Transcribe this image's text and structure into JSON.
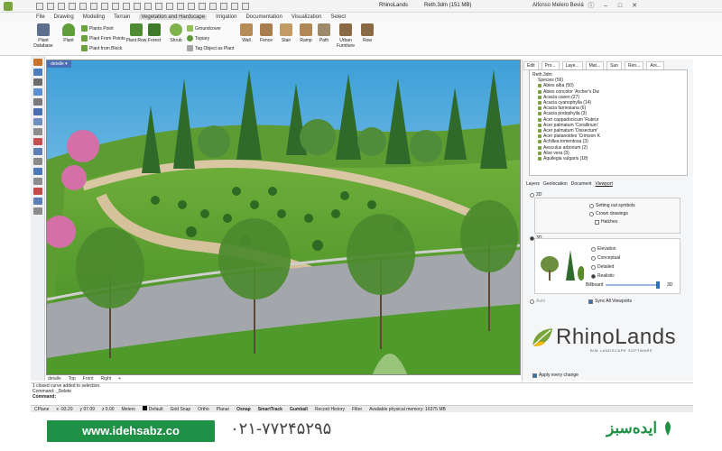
{
  "titlebar": {
    "app_title": "RhinoLands",
    "file_title": "Reth.3dm (151 MB)",
    "user": "Alfonso Melero Beviá"
  },
  "menu": [
    "File",
    "Drawing",
    "Modeling",
    "Terrain",
    "Vegetation and Hardscape",
    "Irrigation",
    "Documentation",
    "Visualization",
    "Select"
  ],
  "ribbon": {
    "plant_database": "Plant Database",
    "plant": "Plant",
    "plants_point": "Plants Point",
    "plant_from_points": "Plant From Points",
    "plant_from_block": "Plant from Block",
    "plant_row": "Plant Row",
    "forest": "Forest",
    "shrub": "Shrub",
    "groundcover": "Groundcover",
    "topiary": "Topiary",
    "tag_object": "Tag Object as Plant",
    "wall": "Wall",
    "fence": "Fence",
    "stair": "Stair",
    "ramp": "Ramp",
    "path": "Path",
    "urban_furniture": "Urban Furniture",
    "row": "Row"
  },
  "viewport": {
    "label": "detalle ▾",
    "tabs": [
      "detalle",
      "Top",
      "Front",
      "Right",
      "+"
    ]
  },
  "panel": {
    "tabs": [
      "Edit",
      "Pro...",
      "Laye...",
      "Mat...",
      "Sun",
      "Ren...",
      "Ani..."
    ],
    "tree_root": "Reth.3dm",
    "tree_group": "Species (56)",
    "species": [
      "Abies alba  (50)",
      "Abies concolor 'Archer's Dw",
      "Acacia caven  (27)",
      "Acacia cyanophylla  (14)",
      "Acacia farnesiana  (6)",
      "Acacia podophylla  (3)",
      "Acer cappadocicum 'Rubrur",
      "Acer palmatum 'Corallinum'",
      "Acer palmatum 'Dissectum'",
      "Acer platanoides 'Crimson K",
      "Achillea tomentosa  (3)",
      "Aesculus arborium  (2)",
      "Aloe vera  (3)",
      "Aquilegia vulgaris  (18)"
    ],
    "subtabs": [
      "Layers",
      "Geolocation",
      "Document",
      "Viewport"
    ],
    "mode_2d": "2D",
    "setting_out": "Setting out symbols",
    "crown_drawings": "Crown drawings",
    "hatches": "Hatches",
    "mode_3d": "3D",
    "elevation": "Elevation",
    "conceptual": "Conceptual",
    "detailed": "Detailed",
    "realistic": "Realistic",
    "billboard": "Billboard",
    "billboard_value": "3D",
    "auto": "Auto",
    "sync": "Sync All Viewports",
    "logo": "RhinoLands",
    "logo_sub": "BIM LANDSCAPE SOFTWARE",
    "apply": "Apply every change"
  },
  "command": {
    "history1": "1 closed curve added to selection.",
    "history2": "Command: _Delete",
    "prompt": "Command:"
  },
  "status": {
    "cplane": "CPlane",
    "x": "x -93.20",
    "y": "y 97.09",
    "z": "z 0.00",
    "units": "Meters",
    "layer": "Default",
    "toggles": [
      "Grid Snap",
      "Ortho",
      "Planar",
      "Osnap",
      "SmartTrack",
      "Gumball",
      "Record History",
      "Filter"
    ],
    "memory": "Available physical memory: 16375 MB"
  },
  "footer": {
    "site": "www.idehsabz.co",
    "phone": "۰۲۱-۷۷۲۴۵۲۹۵",
    "brand": "ایده‌سبز"
  },
  "colors": {
    "accent_green": "#1f9146",
    "logo_green": "#7aa33a",
    "viewport_tab": "#4a6fb4"
  }
}
